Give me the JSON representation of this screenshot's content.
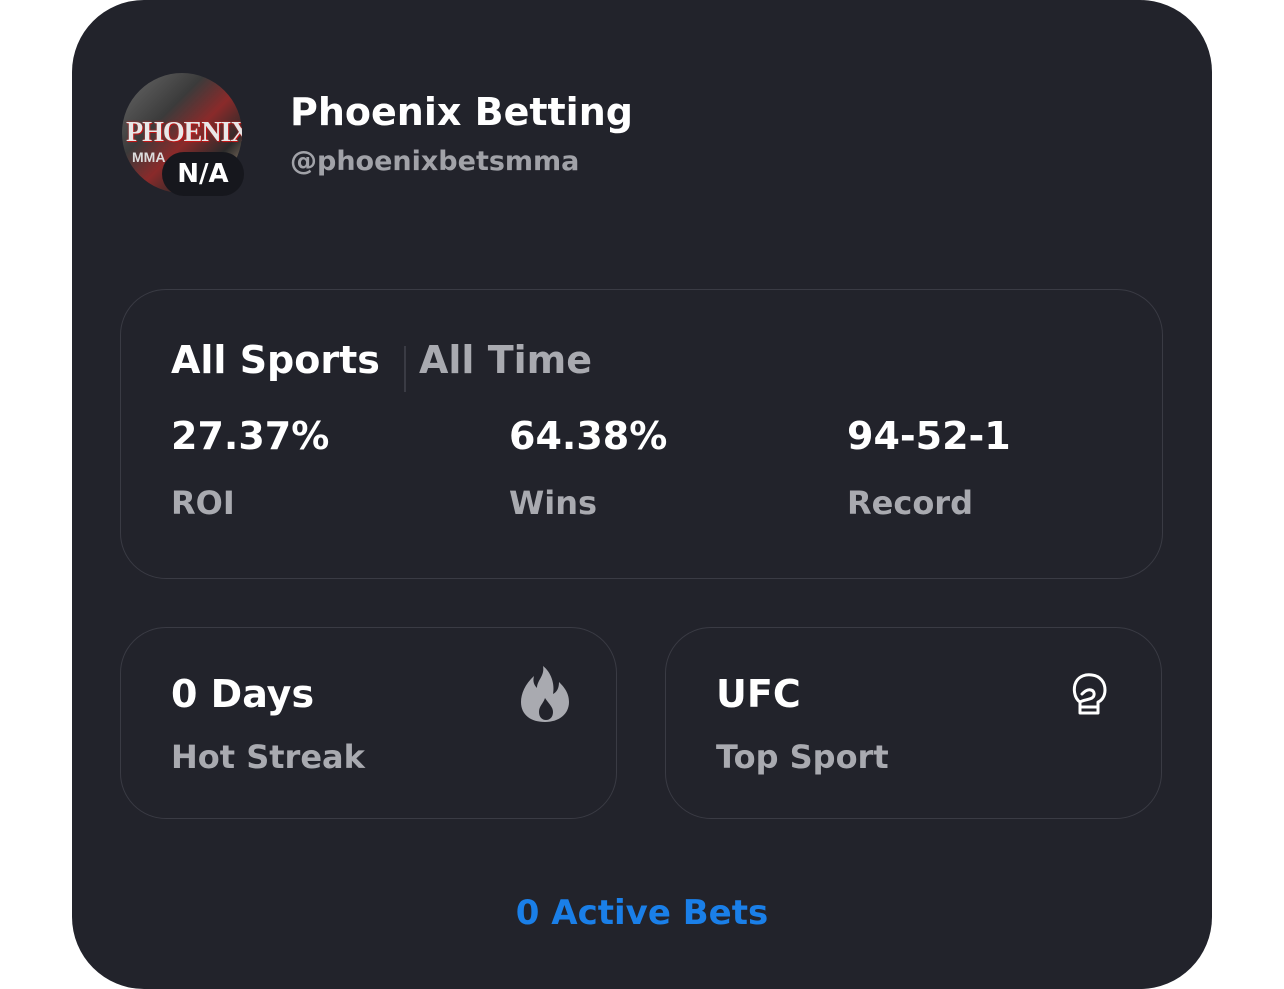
{
  "profile": {
    "name": "Phoenix Betting",
    "handle": "@phoenixbetsmma",
    "badge": "N/A",
    "avatar_text": "PHOENIX",
    "avatar_subtext": "MMA"
  },
  "stats": {
    "filter_sport": "All Sports",
    "filter_time": "All Time",
    "items": [
      {
        "value": "27.37%",
        "label": "ROI"
      },
      {
        "value": "64.38%",
        "label": "Wins"
      },
      {
        "value": "94-52-1",
        "label": "Record"
      }
    ]
  },
  "streak": {
    "value": "0 Days",
    "label": "Hot Streak",
    "icon": "flame-icon"
  },
  "top_sport": {
    "value": "UFC",
    "label": "Top Sport",
    "icon": "boxing-glove-icon"
  },
  "active_bets": "0 Active Bets",
  "colors": {
    "card_bg": "#22232b",
    "border": "#3a3b44",
    "primary_text": "#ffffff",
    "secondary_text": "#a9aab0",
    "accent": "#1a7fe8"
  }
}
